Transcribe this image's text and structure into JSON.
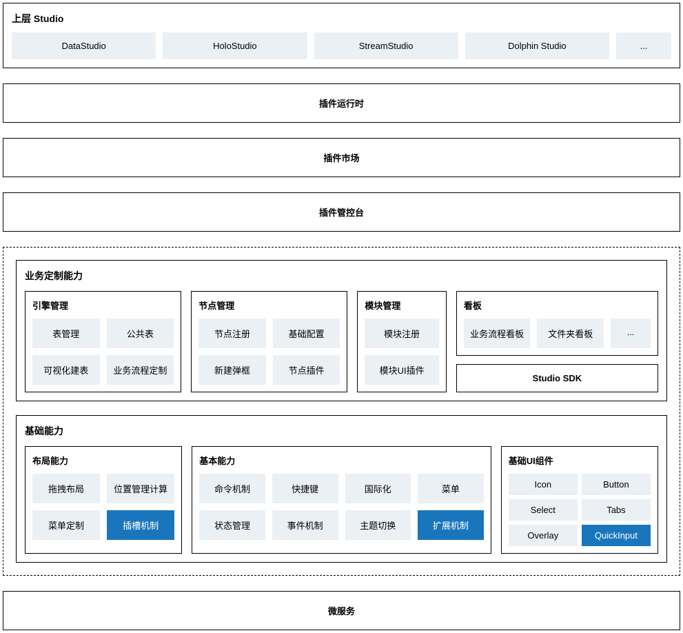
{
  "topStudio": {
    "title": "上层 Studio",
    "items": [
      "DataStudio",
      "HoloStudio",
      "StreamStudio",
      "Dolphin Studio",
      "..."
    ]
  },
  "pluginRuntime": "插件运行时",
  "pluginMarket": "插件市场",
  "pluginConsole": "插件管控台",
  "bizCustom": {
    "title": "业务定制能力",
    "engine": {
      "title": "引擎管理",
      "items": [
        "表管理",
        "公共表",
        "可视化建表",
        "业务流程定制"
      ]
    },
    "node": {
      "title": "节点管理",
      "items": [
        "节点注册",
        "基础配置",
        "新建弹框",
        "节点插件"
      ]
    },
    "module": {
      "title": "模块管理",
      "items": [
        "模块注册",
        "模块UI插件"
      ]
    },
    "kanban": {
      "title": "看板",
      "items": [
        "业务流程看板",
        "文件夹看板",
        "..."
      ]
    },
    "sdk": "Studio SDK"
  },
  "baseAbility": {
    "title": "基础能力",
    "layout": {
      "title": "布局能力",
      "items": [
        "拖拽布局",
        "位置管理计算",
        "菜单定制",
        "插槽机制"
      ]
    },
    "basic": {
      "title": "基本能力",
      "items": [
        "命令机制",
        "快捷键",
        "国际化",
        "菜单",
        "状态管理",
        "事件机制",
        "主题切换",
        "扩展机制"
      ]
    },
    "ui": {
      "title": "基础UI组件",
      "items": [
        "Icon",
        "Button",
        "Select",
        "Tabs",
        "Overlay",
        "QuickInput"
      ]
    }
  },
  "microservice": "微服务"
}
